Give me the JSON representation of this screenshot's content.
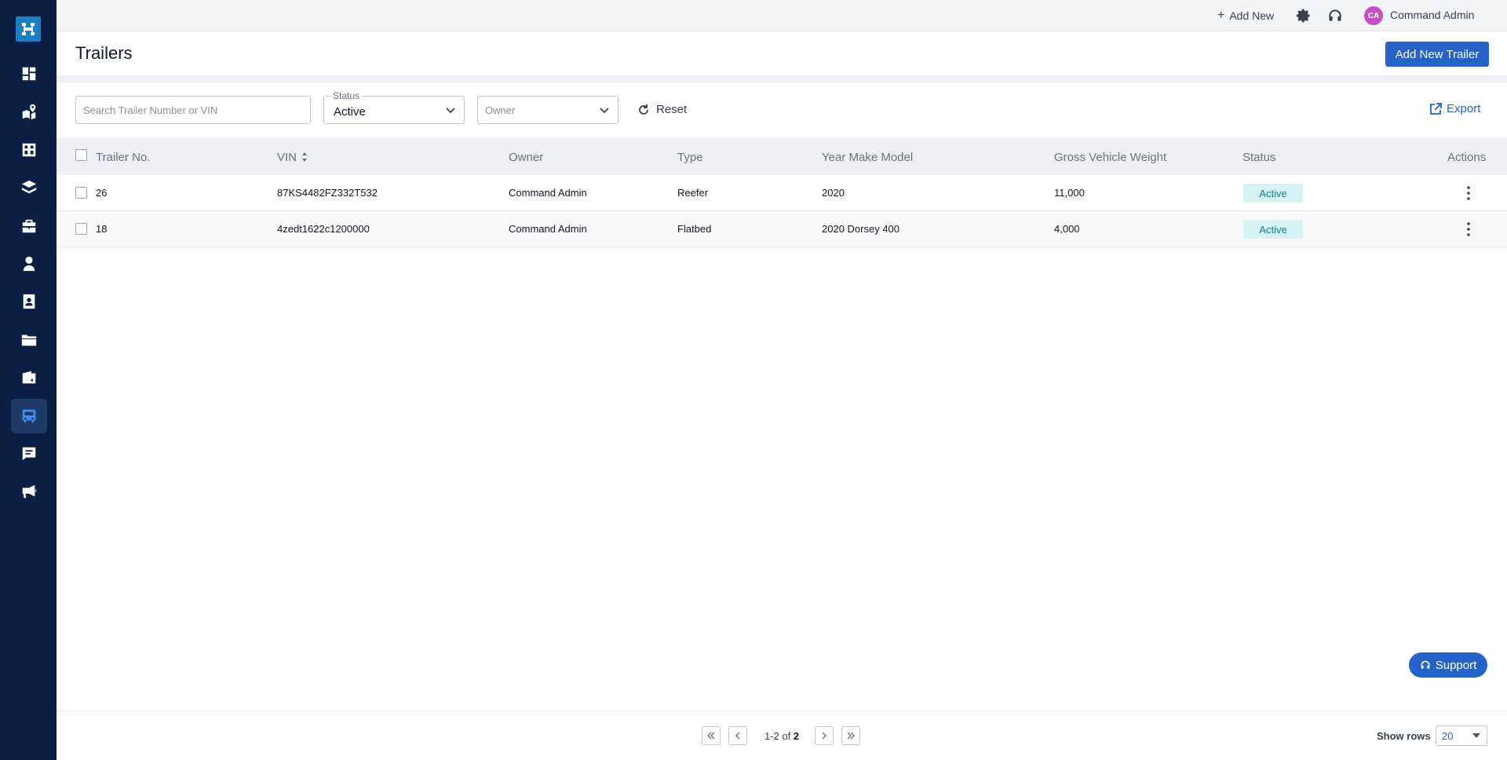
{
  "topbar": {
    "add_new_label": "Add New",
    "avatar_initials": "CA",
    "user_name": "Command Admin"
  },
  "header": {
    "title": "Trailers",
    "add_button_label": "Add New Trailer"
  },
  "filters": {
    "search_placeholder": "Search Trailer Number or VIN",
    "status_legend": "Status",
    "status_value": "Active",
    "owner_placeholder": "Owner",
    "reset_label": "Reset",
    "export_label": "Export"
  },
  "table": {
    "columns": [
      "Trailer No.",
      "VIN",
      "Owner",
      "Type",
      "Year Make Model",
      "Gross Vehicle Weight",
      "Status",
      "Actions"
    ],
    "rows": [
      {
        "trailer_no": "26",
        "vin": "87KS4482FZ332T532",
        "owner": "Command Admin",
        "type": "Reefer",
        "ymm": "2020",
        "gvw": "11,000",
        "status": "Active"
      },
      {
        "trailer_no": "18",
        "vin": "4zedt1622c1200000",
        "owner": "Command Admin",
        "type": "Flatbed",
        "ymm": "2020 Dorsey 400",
        "gvw": "4,000",
        "status": "Active"
      }
    ]
  },
  "support_label": "Support",
  "pagination": {
    "range": "1-2",
    "of_label": "of",
    "total": "2",
    "show_rows_label": "Show rows",
    "rows_per_page": "20"
  },
  "colors": {
    "sidebar": "#0b1f44",
    "primary": "#2563c9",
    "badge_bg": "#d6f2f4",
    "badge_text": "#0e7f8a"
  }
}
